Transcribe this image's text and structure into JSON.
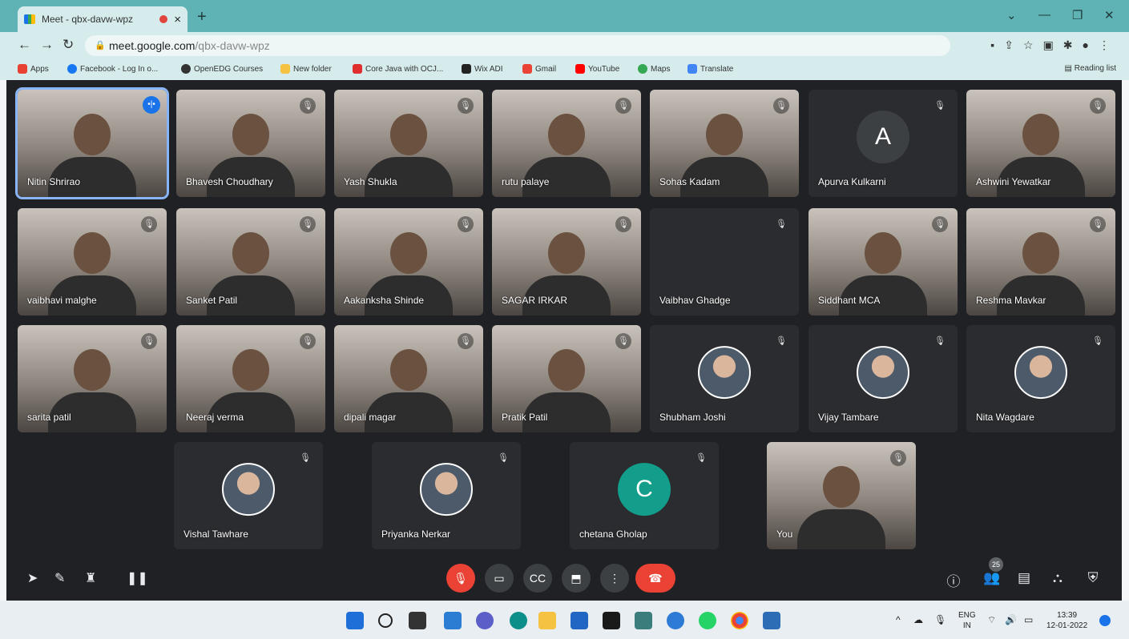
{
  "browser": {
    "tab_title": "Meet - qbx-davw-wpz",
    "url_host": "meet.google.com",
    "url_path": "/qbx-davw-wpz",
    "bookmarks": [
      {
        "label": "Apps",
        "color": "#e94235"
      },
      {
        "label": "Facebook - Log In o...",
        "color": "#1877f2"
      },
      {
        "label": "OpenEDG Courses",
        "color": "#333333"
      },
      {
        "label": "New folder",
        "color": "#f6c244"
      },
      {
        "label": "Core Java with OCJ...",
        "color": "#e02d2d"
      },
      {
        "label": "Wix ADI",
        "color": "#222222"
      },
      {
        "label": "Gmail",
        "color": "#ea4335"
      },
      {
        "label": "YouTube",
        "color": "#ff0000"
      },
      {
        "label": "Maps",
        "color": "#34a853"
      },
      {
        "label": "Translate",
        "color": "#4285f4"
      }
    ],
    "reading_list": "Reading list"
  },
  "participants": [
    {
      "name": "Nitin Shrirao",
      "kind": "video",
      "active": true
    },
    {
      "name": "Bhavesh Choudhary",
      "kind": "video"
    },
    {
      "name": "Yash Shukla",
      "kind": "video"
    },
    {
      "name": "rutu palaye",
      "kind": "video"
    },
    {
      "name": "Sohas Kadam",
      "kind": "video"
    },
    {
      "name": "Apurva Kulkarni",
      "kind": "letter",
      "letter": "A",
      "color": "#3c4043"
    },
    {
      "name": "Ashwini Yewatkar",
      "kind": "video"
    },
    {
      "name": "vaibhavi malghe",
      "kind": "video"
    },
    {
      "name": "Sanket Patil",
      "kind": "video"
    },
    {
      "name": "Aakanksha Shinde",
      "kind": "video"
    },
    {
      "name": "SAGAR IRKAR",
      "kind": "video"
    },
    {
      "name": "Vaibhav Ghadge",
      "kind": "dark"
    },
    {
      "name": "Siddhant MCA",
      "kind": "video"
    },
    {
      "name": "Reshma Mavkar",
      "kind": "video"
    },
    {
      "name": "sarita patil",
      "kind": "video"
    },
    {
      "name": "Neeraj verma",
      "kind": "video"
    },
    {
      "name": "dipali magar",
      "kind": "video"
    },
    {
      "name": "Pratik Patil",
      "kind": "video"
    },
    {
      "name": "Shubham Joshi",
      "kind": "avatar"
    },
    {
      "name": "Vijay Tambare",
      "kind": "avatar"
    },
    {
      "name": "Nita Wagdare",
      "kind": "avatar"
    },
    {
      "name": "Vishal Tawhare",
      "kind": "avatar"
    },
    {
      "name": "Priyanka Nerkar",
      "kind": "avatar"
    },
    {
      "name": "chetana Gholap",
      "kind": "letter",
      "letter": "C",
      "color": "#129e8a"
    },
    {
      "name": "You",
      "kind": "video"
    }
  ],
  "participant_count": "25",
  "taskbar": {
    "lang_top": "ENG",
    "lang_bottom": "IN",
    "time": "13:39",
    "date": "12-01-2022"
  }
}
